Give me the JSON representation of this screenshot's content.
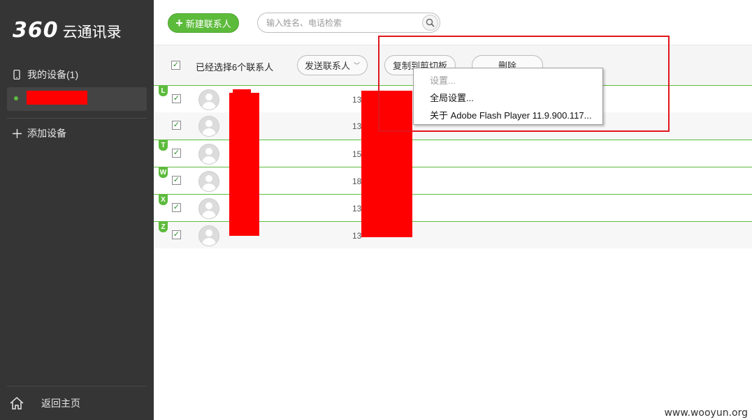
{
  "app": {
    "logo_number": "360",
    "logo_text": "云通讯录"
  },
  "sidebar": {
    "my_devices": "我的设备(1)",
    "add_device": "添加设备",
    "back_home": "返回主页"
  },
  "toolbar": {
    "new_contact": "新建联系人",
    "search_placeholder": "输入姓名、电话检索"
  },
  "actions": {
    "selected_text": "已经选择6个联系人",
    "send_contacts": "发送联系人",
    "copy_clipboard": "复制到剪切板",
    "delete": "删除"
  },
  "contacts": [
    {
      "letter": "L",
      "phone_prefix": "13"
    },
    {
      "letter": "",
      "phone_prefix": "13"
    },
    {
      "letter": "T",
      "phone_prefix": "15"
    },
    {
      "letter": "W",
      "phone_prefix": "18"
    },
    {
      "letter": "X",
      "phone_prefix": "13"
    },
    {
      "letter": "Z",
      "phone_prefix": "13"
    }
  ],
  "context_menu": {
    "settings": "设置...",
    "global_settings": "全局设置...",
    "about": "关于 Adobe Flash Player 11.9.900.117..."
  },
  "watermark": "www.wooyun.org",
  "colors": {
    "accent": "#5dbb3c",
    "sidebar_bg": "#353535",
    "highlight": "#e0161c",
    "redaction": "#ff0000"
  },
  "icons": [
    "phone-icon",
    "plus-icon",
    "home-icon",
    "search-icon",
    "avatar-icon",
    "checkbox-icon",
    "chevron-down-icon"
  ]
}
